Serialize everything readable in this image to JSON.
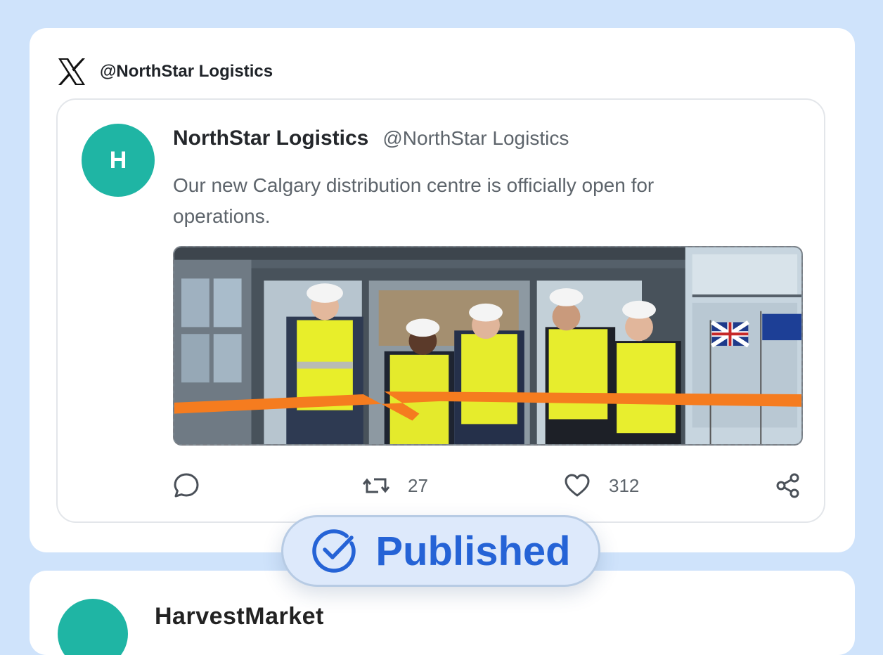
{
  "platform": {
    "icon": "x-logo-icon",
    "handle": "@NorthStar Logistics"
  },
  "post": {
    "avatar_initial": "H",
    "avatar_color": "#1fb5a4",
    "author_name": "NorthStar Logistics",
    "author_handle": "@NorthStar Logistics",
    "text": "Our new Calgary distribution centre is officially open for operations.",
    "image_alt": "Ribbon-cutting ceremony with five people in hard hats and hi-vis vests",
    "actions": {
      "reply": {
        "icon": "comment-icon"
      },
      "repost": {
        "icon": "repost-icon",
        "count": "27"
      },
      "like": {
        "icon": "heart-icon",
        "count": "312"
      },
      "share": {
        "icon": "share-icon"
      }
    }
  },
  "status_badge": {
    "icon": "check-circle-icon",
    "label": "Published",
    "color": "#2563d6"
  },
  "next_post": {
    "author_name": "HarvestMarket"
  }
}
